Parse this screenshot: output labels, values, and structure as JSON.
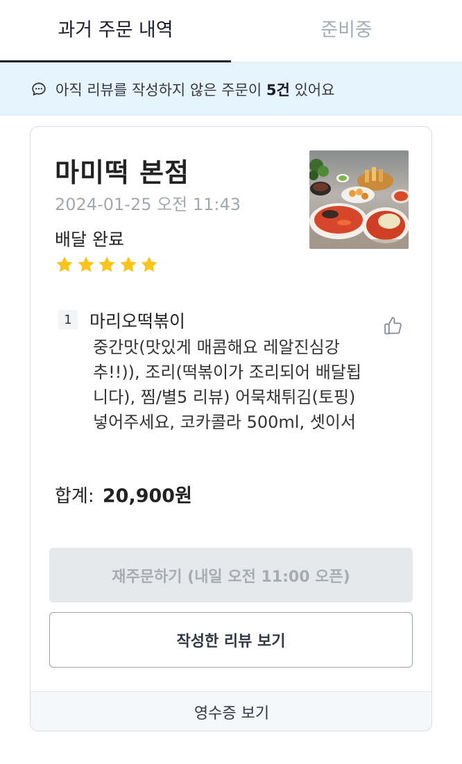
{
  "tabs": [
    {
      "label": "과거 주문 내역",
      "active": true
    },
    {
      "label": "준비중",
      "active": false
    }
  ],
  "banner": {
    "icon": "chat-bubble-icon",
    "prefix": "아직 리뷰를 작성하지 않은 주문이 ",
    "count": "5건",
    "suffix": " 있어요"
  },
  "order": {
    "store_name": "마미떡 본점",
    "date": "2024-01-25 오전 11:43",
    "status": "배달 완료",
    "rating": 5,
    "item": {
      "quantity": "1",
      "name": "마리오떡볶이",
      "options": "중간맛(맛있게 매콤해요 레알진심강추!!)), 조리(떡볶이가 조리되어 배달됩니다), 찜/별5 리뷰) 어묵채튀김(토핑) 넣어주세요, 코카콜라 500ml, 셋이서"
    },
    "total_label": "합계:",
    "total_amount": "20,900원",
    "reorder_label": "재주문하기 (내일 오전 11:00 오픈)",
    "review_label": "작성한 리뷰 보기",
    "receipt_label": "영수증 보기"
  },
  "colors": {
    "accent": "#1b1c2e",
    "star": "#fcc419",
    "banner_bg": "#e5f4fd"
  }
}
